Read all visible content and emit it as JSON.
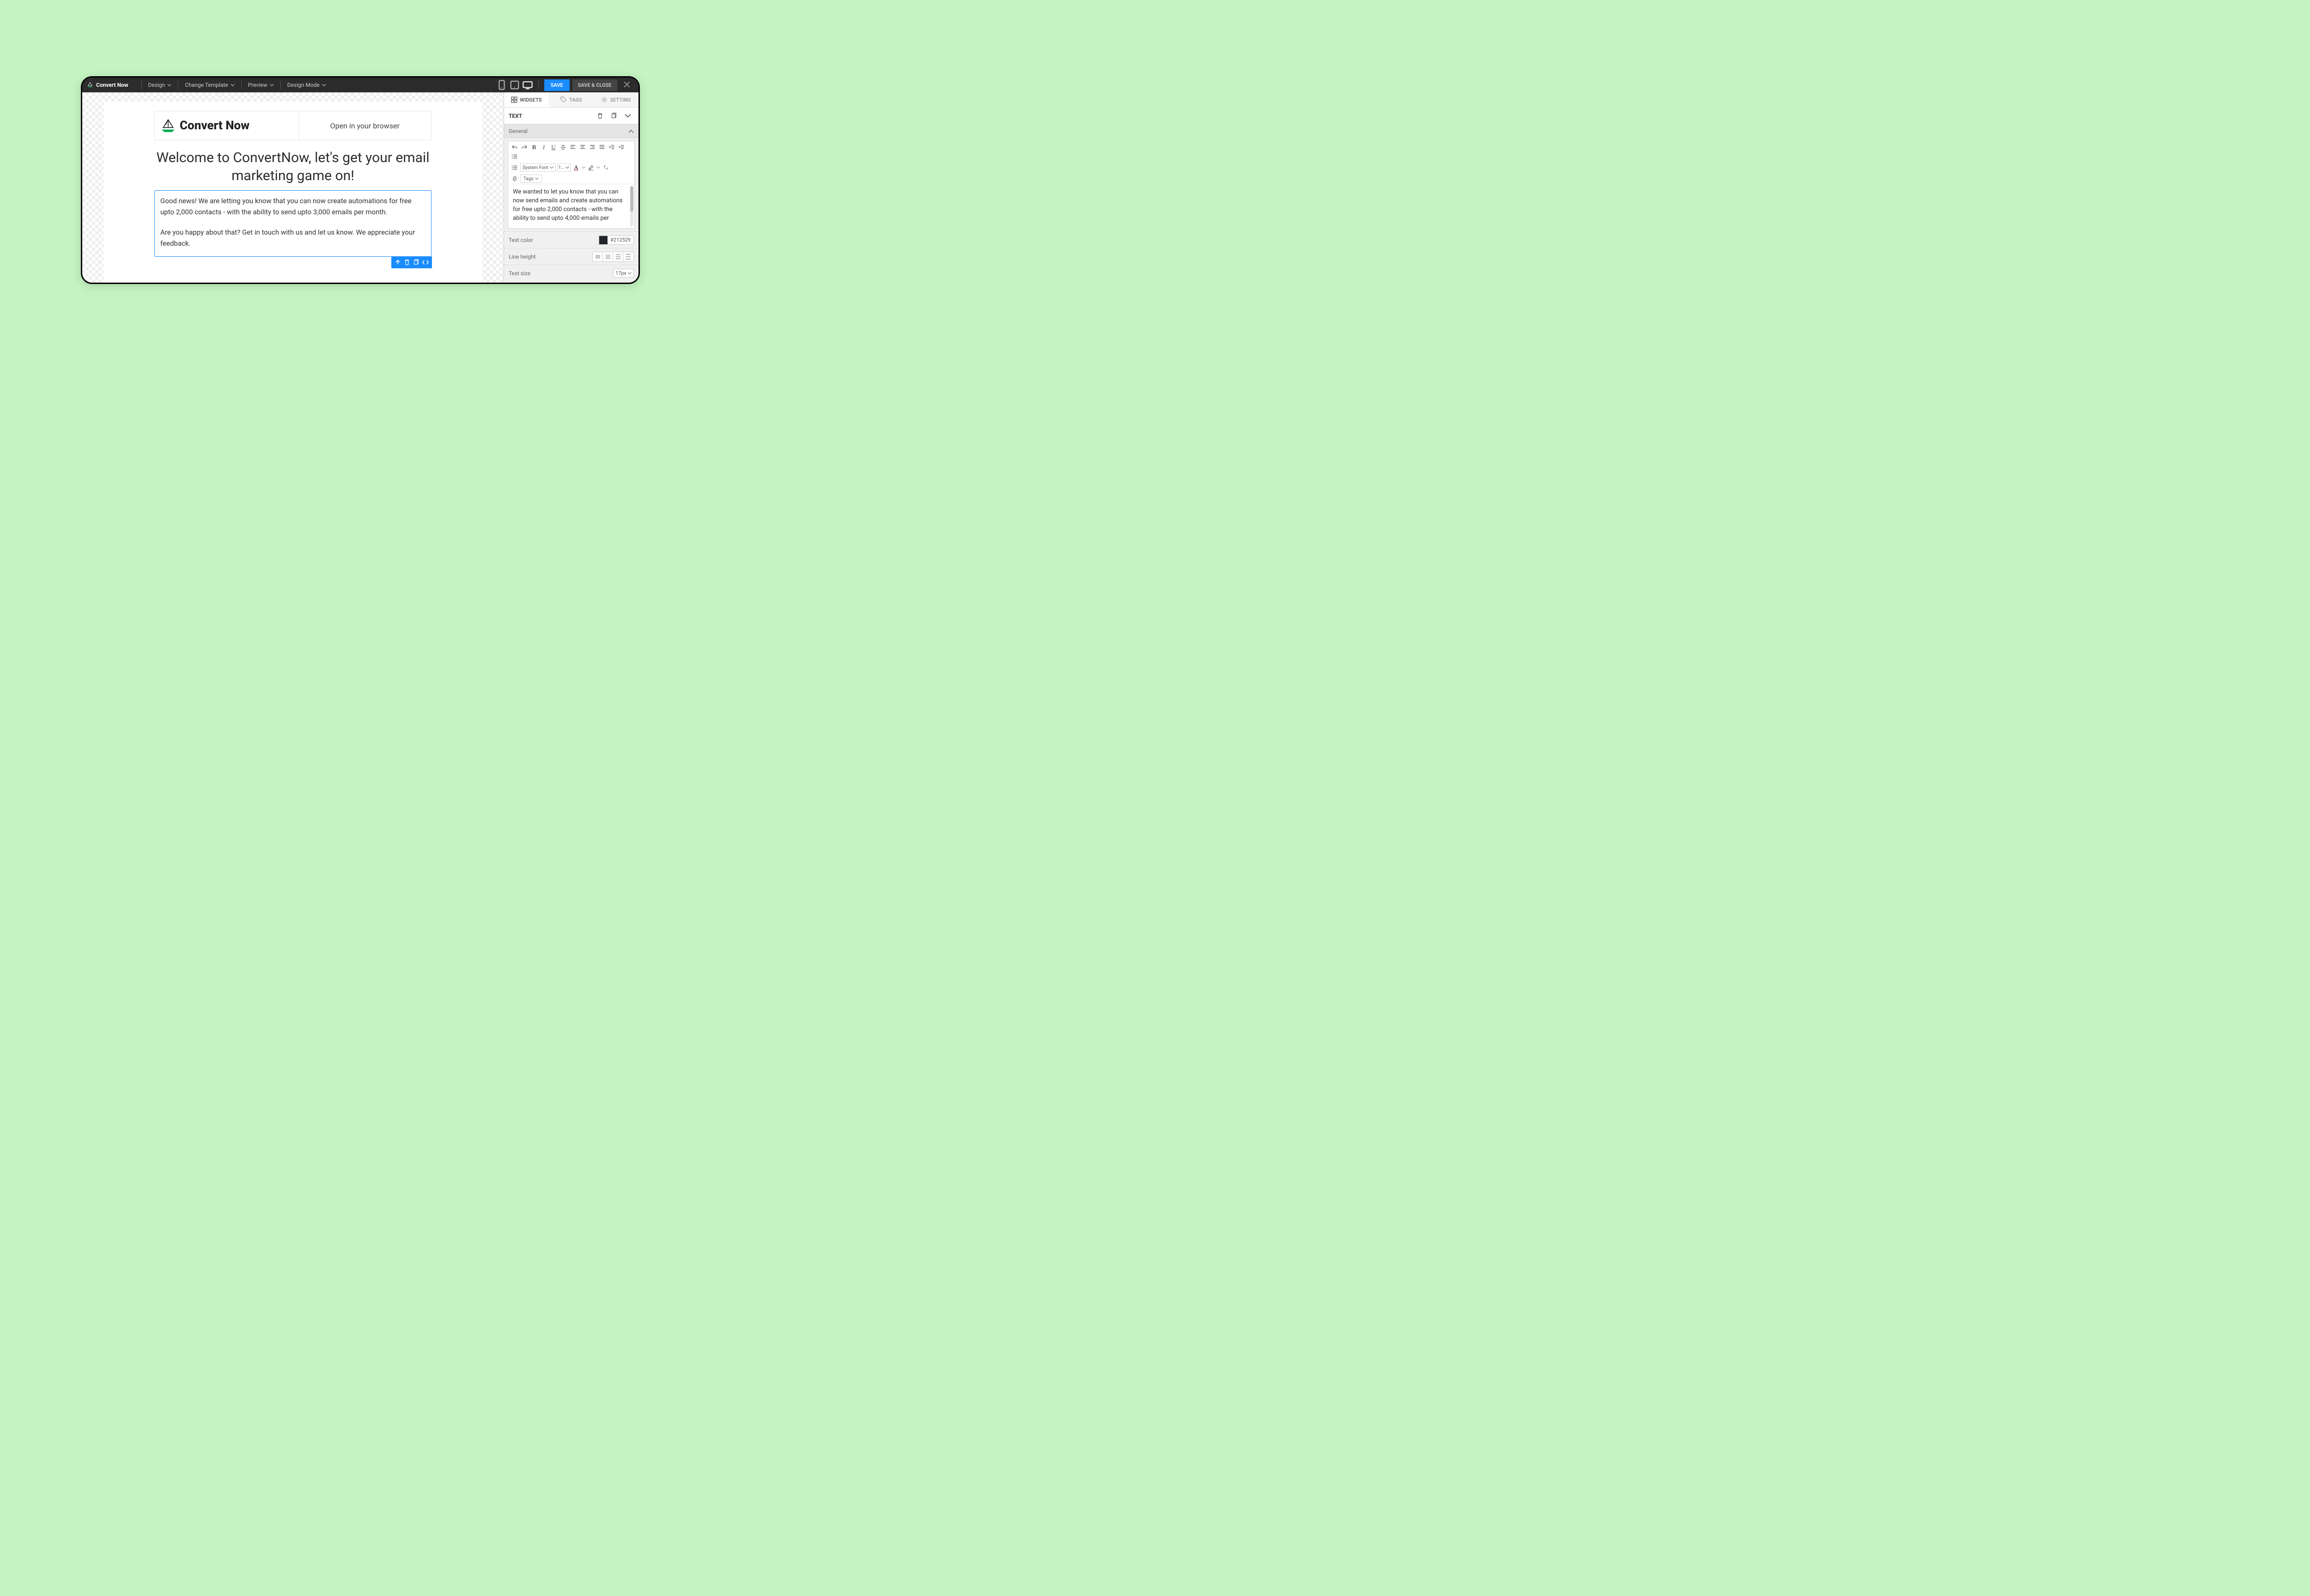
{
  "topbar": {
    "brand": "Convert Now",
    "menu": {
      "design": "Design",
      "template": "Change Template",
      "preview": "Preview",
      "mode": "Design Mode"
    },
    "save": "SAVE",
    "save_close": "SAVE & CLOSE"
  },
  "email": {
    "brand": "Convert Now",
    "browser_link": "Open in your browser",
    "headline": "Welcome to ConvertNow, let's get your email marketing game on!",
    "para1": "Good news! We are letting you know that you can now create automations for free upto 2,000 contacts - with the ability to send upto 3,000 emails per month.",
    "para2": "Are you happy about that? Get in touch with us and let us know. We appreciate your feedback."
  },
  "sidebar": {
    "tabs": {
      "widgets": "WIDGETS",
      "tags": "TAGS",
      "setting": "SETTING"
    },
    "panel_title": "TEXT",
    "general": "General",
    "rte": {
      "font": "System Font",
      "size_short": "1…",
      "tags_btn": "Tags",
      "content": "We wanted to let you know that you can now send emails and create automations for free upto 2,000 contacts - with the ability to send upto 4,000 emails per"
    },
    "props": {
      "text_color_label": "Text color",
      "text_color_value": "#212529",
      "line_height_label": "Line height",
      "text_size_label": "Text size",
      "text_size_value": "17px"
    }
  }
}
